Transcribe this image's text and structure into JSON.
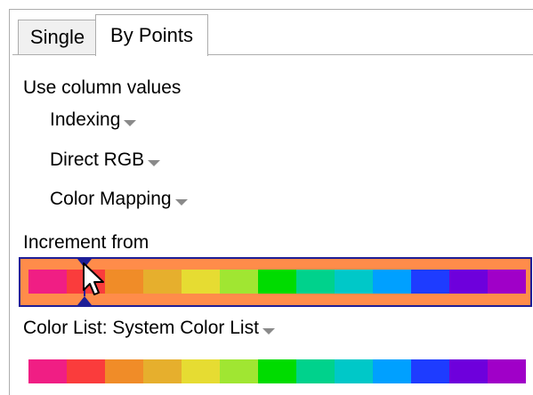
{
  "tabs": {
    "single": "Single",
    "by_points": "By Points"
  },
  "use_column_values": {
    "label": "Use column values",
    "indexing": "Indexing",
    "direct_rgb": "Direct RGB",
    "color_mapping": "Color Mapping"
  },
  "increment_from": {
    "label": "Increment from"
  },
  "color_list": {
    "label": "Color List: System Color List"
  },
  "colors": [
    "#f01e84",
    "#fa3c3c",
    "#f08c28",
    "#e6af2d",
    "#e6dc32",
    "#a0e632",
    "#00dc00",
    "#00d28c",
    "#00c8c8",
    "#00a0ff",
    "#1e3cff",
    "#6e00dc",
    "#a000c8"
  ],
  "accent": "#1e1e96",
  "highlight": "#ff8c4a",
  "icons": {
    "dropdown": "chevron-down-icon",
    "cursor": "mouse-pointer-icon",
    "marker": "position-marker-icon"
  }
}
